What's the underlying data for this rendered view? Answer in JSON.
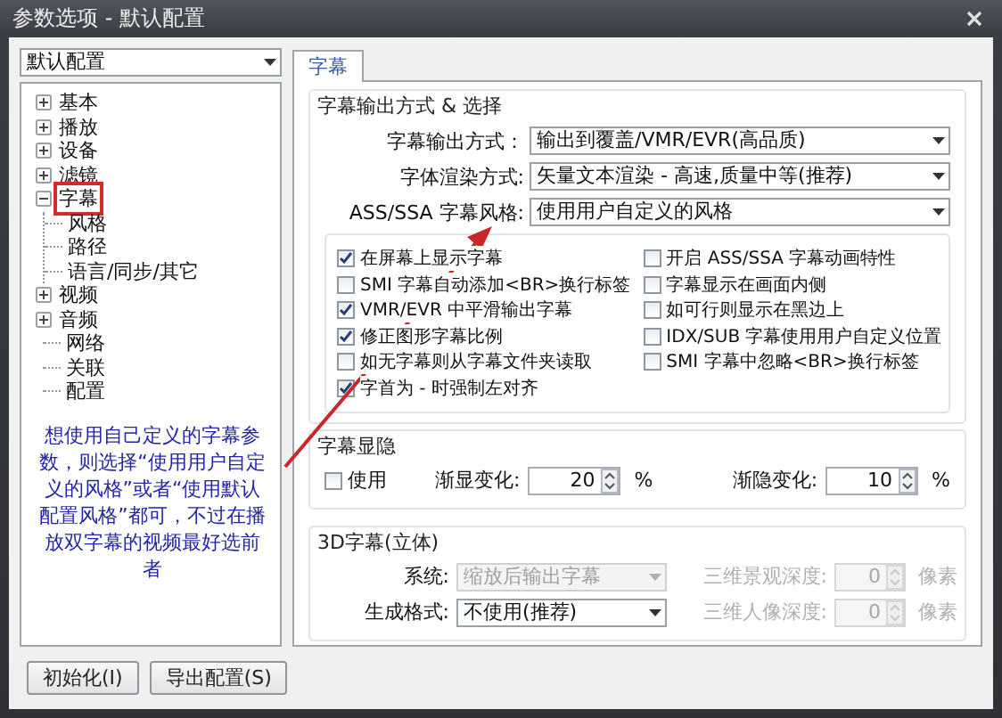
{
  "window": {
    "title": "参数选项 - 默认配置"
  },
  "profile": {
    "value": "默认配置"
  },
  "tree": [
    {
      "label": "基本",
      "kind": "folder",
      "expanded": false,
      "annotated": false
    },
    {
      "label": "播放",
      "kind": "folder",
      "expanded": false,
      "annotated": false
    },
    {
      "label": "设备",
      "kind": "folder",
      "expanded": false,
      "annotated": false
    },
    {
      "label": "滤镜",
      "kind": "folder",
      "expanded": false,
      "annotated": false
    },
    {
      "label": "字幕",
      "kind": "folder",
      "expanded": true,
      "annotated": true,
      "children": [
        {
          "label": "风格"
        },
        {
          "label": "路径"
        },
        {
          "label": "语言/同步/其它"
        }
      ]
    },
    {
      "label": "视频",
      "kind": "folder",
      "expanded": false,
      "annotated": false
    },
    {
      "label": "音频",
      "kind": "folder",
      "expanded": false,
      "annotated": false
    },
    {
      "label": "网络",
      "kind": "leaf",
      "annotated": false
    },
    {
      "label": "关联",
      "kind": "leaf",
      "annotated": false
    },
    {
      "label": "配置",
      "kind": "leaf",
      "annotated": false
    }
  ],
  "note": "想使用自己定义的字幕参数，则选择“使用用户自定义的风格”或者“使用默认配置风格”都可，不过在播放双字幕的视频最好选前者",
  "buttons": [
    "初始化(I)",
    "导出配置(S)"
  ],
  "tabs": [
    {
      "label": "字幕",
      "selected": true
    }
  ],
  "output_group": {
    "title": "字幕输出方式 & 选择",
    "fields": [
      {
        "label": "字幕输出方式：",
        "value": "输出到覆盖/VMR/EVR(高品质)"
      },
      {
        "label": "字体渲染方式:",
        "value": "矢量文本渲染 - 高速,质量中等(推荐)"
      },
      {
        "label": "ASS/SSA 字幕风格:",
        "value": "使用用户自定义的风格"
      }
    ]
  },
  "options_left": [
    {
      "label": "在屏幕上显示字幕",
      "checked": true
    },
    {
      "label": "SMI 字幕自动添加<BR>换行标签",
      "checked": false
    },
    {
      "label": "VMR/EVR 中平滑输出字幕",
      "checked": true
    },
    {
      "label": "修正图形字幕比例",
      "checked": true
    },
    {
      "label": "如无字幕则从字幕文件夹读取",
      "checked": false
    },
    {
      "label": "字首为 - 时强制左对齐",
      "checked": true
    }
  ],
  "options_right": [
    {
      "label": "开启 ASS/SSA 字幕动画特性",
      "checked": false
    },
    {
      "label": "字幕显示在画面内侧",
      "checked": false
    },
    {
      "label": "如可行则显示在黑边上",
      "checked": false
    },
    {
      "label": "IDX/SUB 字幕使用用户自定义位置",
      "checked": false
    },
    {
      "label": "SMI 字幕中忽略<BR>换行标签",
      "checked": false
    }
  ],
  "fade_group": {
    "title": "字幕显隐",
    "use": {
      "label": "使用",
      "checked": false
    },
    "spinners": [
      {
        "label": "渐显变化:",
        "value": "20",
        "unit": "%"
      },
      {
        "label": "渐隐变化:",
        "value": "10",
        "unit": "%"
      }
    ]
  },
  "stereo_group": {
    "title": "3D字幕(立体)",
    "rows": [
      {
        "label": "系统:",
        "value": "缩放后输出字幕",
        "disabled": true,
        "spin_label": "三维景观深度:",
        "spin_value": "0",
        "spin_unit": "像素",
        "spin_disabled": true
      },
      {
        "label": "生成格式:",
        "value": "不使用(推荐)",
        "disabled": false,
        "spin_label": "三维人像深度:",
        "spin_value": "0",
        "spin_unit": "像素",
        "spin_disabled": true
      }
    ]
  }
}
